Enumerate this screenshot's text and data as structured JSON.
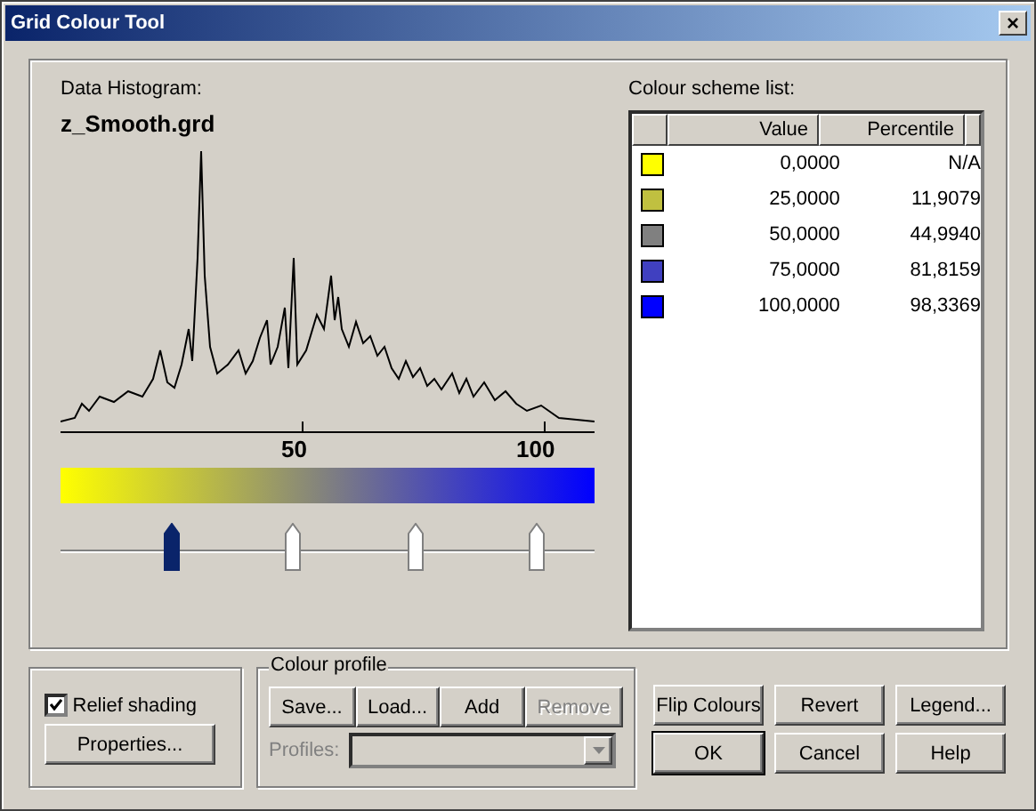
{
  "window": {
    "title": "Grid Colour Tool",
    "close": "×"
  },
  "histogram": {
    "label": "Data Histogram:",
    "file": "z_Smooth.grd",
    "axis_labels": [
      "50",
      "100"
    ]
  },
  "gradient_stops": [
    {
      "selected": true,
      "level": 0.207
    },
    {
      "selected": false,
      "level": 0.433
    },
    {
      "selected": false,
      "level": 0.663
    },
    {
      "selected": false,
      "level": 0.89
    }
  ],
  "colour_scheme": {
    "label": "Colour scheme list:",
    "columns": [
      "Value",
      "Percentile"
    ],
    "rows": [
      {
        "color": "#ffff00",
        "value": "0,0000",
        "percentile": "N/A"
      },
      {
        "color": "#c0c040",
        "value": "25,0000",
        "percentile": "11,9079"
      },
      {
        "color": "#808080",
        "value": "50,0000",
        "percentile": "44,9940"
      },
      {
        "color": "#4040c0",
        "value": "75,0000",
        "percentile": "81,8159"
      },
      {
        "color": "#0000ff",
        "value": "100,0000",
        "percentile": "98,3369"
      }
    ]
  },
  "relief": {
    "label": "Relief shading",
    "checked": true,
    "button": "Properties..."
  },
  "colour_profile": {
    "title": "Colour profile",
    "buttons": [
      {
        "label": "Save...",
        "disabled": false
      },
      {
        "label": "Load...",
        "disabled": false
      },
      {
        "label": "Add",
        "disabled": false
      },
      {
        "label": "Remove",
        "disabled": true
      }
    ],
    "profiles_label": "Profiles:",
    "disabled": true
  },
  "buttons": [
    {
      "label": "Flip Colours",
      "default": false
    },
    {
      "label": "Revert",
      "default": false
    },
    {
      "label": "Legend...",
      "default": false
    },
    {
      "label": "OK",
      "default": true
    },
    {
      "label": "Cancel",
      "default": false
    },
    {
      "label": "Help",
      "default": false
    }
  ]
}
